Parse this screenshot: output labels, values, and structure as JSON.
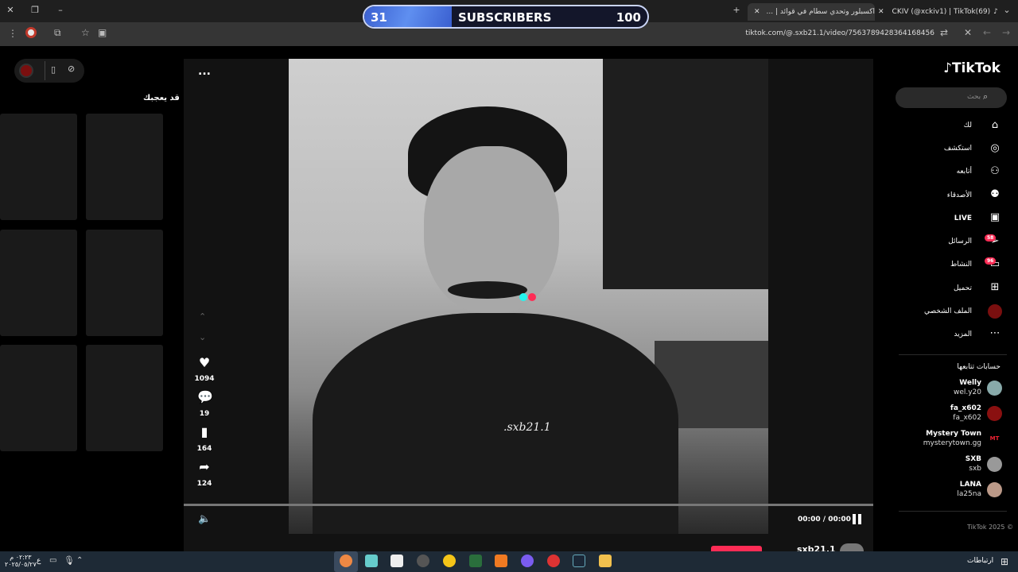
{
  "browser": {
    "tabs": [
      {
        "title": "CKIV (@xckiv1) | TikTok(69)"
      },
      {
        "title": "اكسبلور وتحدي سطام في قوائد | ..."
      }
    ],
    "url": "tiktok.com/@.sxb21.1/video/7563789428364168456"
  },
  "overlay": {
    "current": "31",
    "label": "SUBSCRIBERS",
    "goal": "100",
    "progress_fraction": 0.31
  },
  "left_panel": {
    "title": "قد يعجبك"
  },
  "video": {
    "watermark": ".sxb21.1",
    "more_label": "...",
    "likes": "1094",
    "comments": "19",
    "saves": "164",
    "shares": "124",
    "time": "00:00 / 00:00",
    "author_peek": "sxb21.1"
  },
  "sidebar": {
    "logo": "TikTok",
    "search_placeholder": "بحث",
    "nav": [
      {
        "label": "لك",
        "icon": "home-icon"
      },
      {
        "label": "استكشف",
        "icon": "compass-icon"
      },
      {
        "label": "أتابعه",
        "icon": "user-plus-icon"
      },
      {
        "label": "الأصدقاء",
        "icon": "friends-icon"
      },
      {
        "label": "LIVE",
        "icon": "live-icon"
      },
      {
        "label": "الرسائل",
        "icon": "messages-icon",
        "badge": "58"
      },
      {
        "label": "النشاط",
        "icon": "activity-icon",
        "badge": "96"
      },
      {
        "label": "تحميل",
        "icon": "upload-icon"
      },
      {
        "label": "الملف الشخصي",
        "icon": "profile-avatar"
      },
      {
        "label": "المزيد",
        "icon": "more-icon"
      }
    ],
    "following_header": "حسابات تتابعها",
    "following": [
      {
        "name": "Welly",
        "user": "wel.y20"
      },
      {
        "name": "fa_x602",
        "user": "fa_x602"
      },
      {
        "name": "Mystery Town",
        "user": "mysterytown.gg",
        "avatar_text": "MT"
      },
      {
        "name": "SXB",
        "user": "sxb"
      },
      {
        "name": "LANA",
        "user": "la25na"
      }
    ],
    "copyright": "TikTok 2025 ©"
  },
  "taskbar": {
    "time": "٠٢:٢٣ م",
    "date": "٢٠٢٥/٠٥/٢٧",
    "lang": "ع",
    "left_label": "ارتباطات"
  },
  "colors": {
    "accent": "#fe2c55",
    "bar_fill": "#4a74e0"
  }
}
